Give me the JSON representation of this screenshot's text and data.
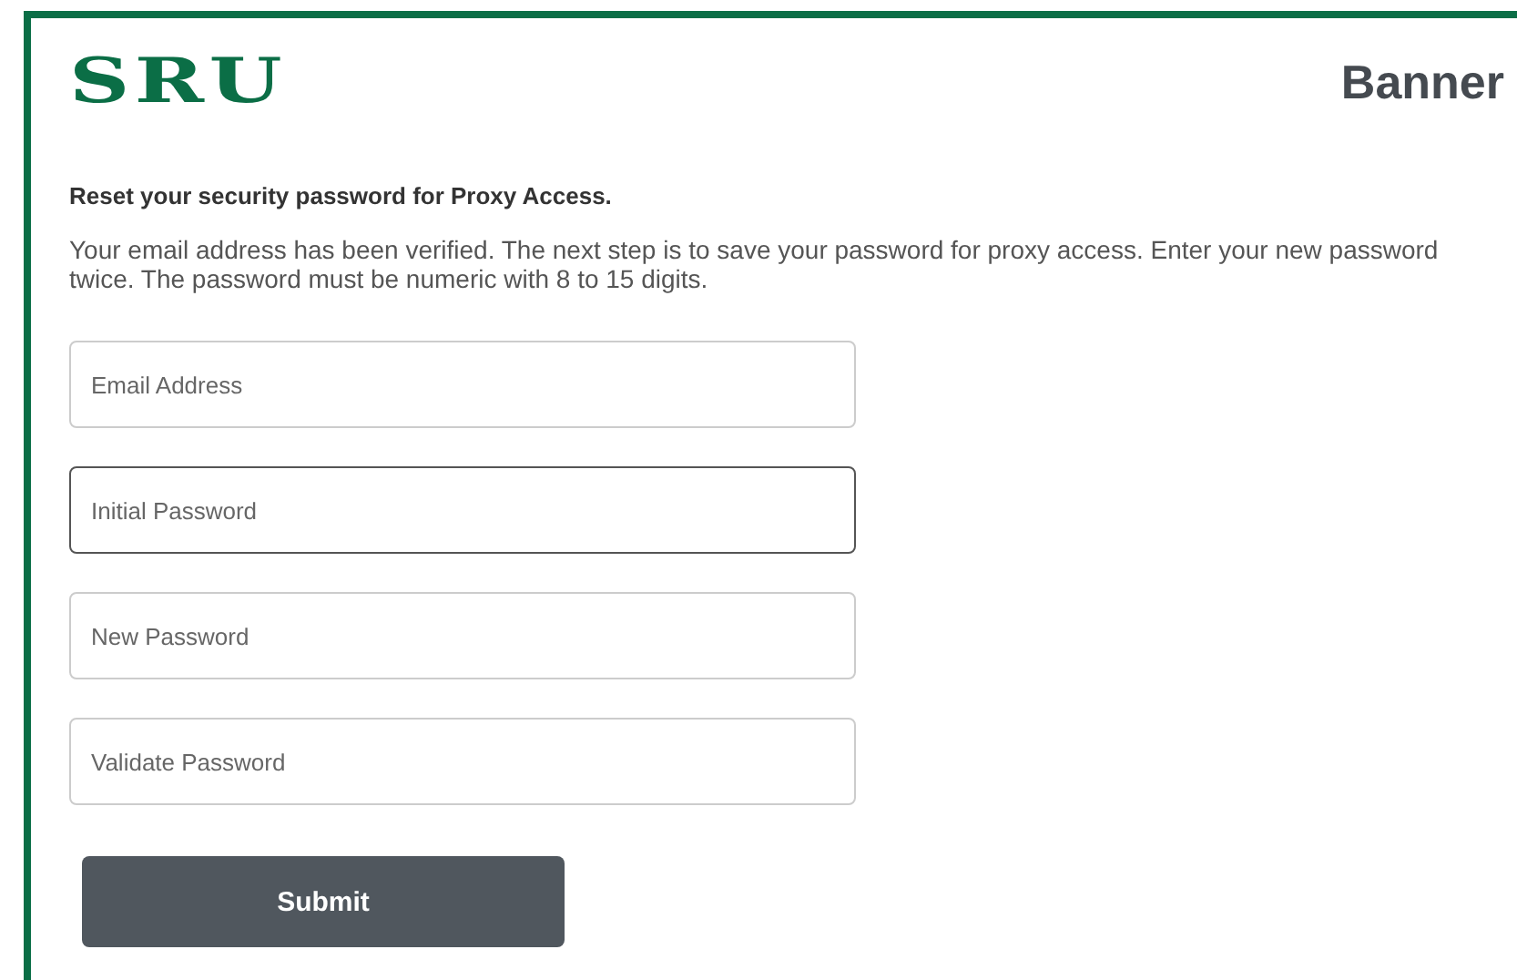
{
  "header": {
    "logo": "SRU",
    "product": "Banner"
  },
  "heading": "Reset your security password for Proxy Access.",
  "instructions": "Your email address has been verified. The next step is to save your password for proxy access. Enter your new password twice. The password must be numeric with 8 to 15 digits.",
  "fields": [
    {
      "placeholder": "Email Address",
      "focused": false
    },
    {
      "placeholder": "Initial Password",
      "focused": true
    },
    {
      "placeholder": "New Password",
      "focused": false
    },
    {
      "placeholder": "Validate Password",
      "focused": false
    }
  ],
  "submit": "Submit"
}
